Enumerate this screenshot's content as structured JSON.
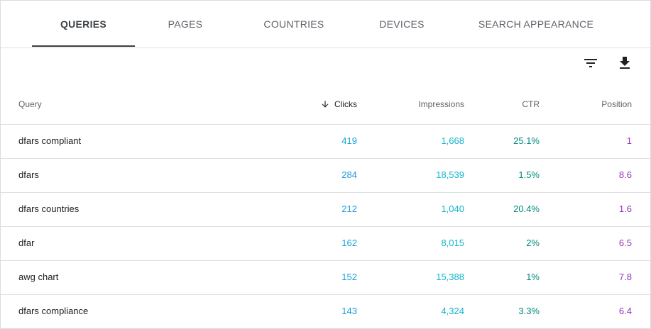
{
  "tabs": [
    {
      "label": "QUERIES",
      "active": true
    },
    {
      "label": "PAGES",
      "active": false
    },
    {
      "label": "COUNTRIES",
      "active": false
    },
    {
      "label": "DEVICES",
      "active": false
    },
    {
      "label": "SEARCH APPEARANCE",
      "active": false
    }
  ],
  "toolbar": {
    "filter_icon": "filter-icon",
    "download_icon": "download-icon"
  },
  "table": {
    "headers": {
      "query": "Query",
      "clicks": "Clicks",
      "impressions": "Impressions",
      "ctr": "CTR",
      "position": "Position"
    },
    "sorted_by": "clicks",
    "rows": [
      {
        "query": "dfars compliant",
        "clicks": "419",
        "impressions": "1,668",
        "ctr": "25.1%",
        "position": "1"
      },
      {
        "query": "dfars",
        "clicks": "284",
        "impressions": "18,539",
        "ctr": "1.5%",
        "position": "8.6"
      },
      {
        "query": "dfars countries",
        "clicks": "212",
        "impressions": "1,040",
        "ctr": "20.4%",
        "position": "1.6"
      },
      {
        "query": "dfar",
        "clicks": "162",
        "impressions": "8,015",
        "ctr": "2%",
        "position": "6.5"
      },
      {
        "query": "awg chart",
        "clicks": "152",
        "impressions": "15,388",
        "ctr": "1%",
        "position": "7.8"
      },
      {
        "query": "dfars compliance",
        "clicks": "143",
        "impressions": "4,324",
        "ctr": "3.3%",
        "position": "6.4"
      }
    ]
  },
  "colors": {
    "clicks": "#1a9fd8",
    "impressions": "#12b5cb",
    "ctr": "#00897b",
    "position": "#9334b9"
  }
}
